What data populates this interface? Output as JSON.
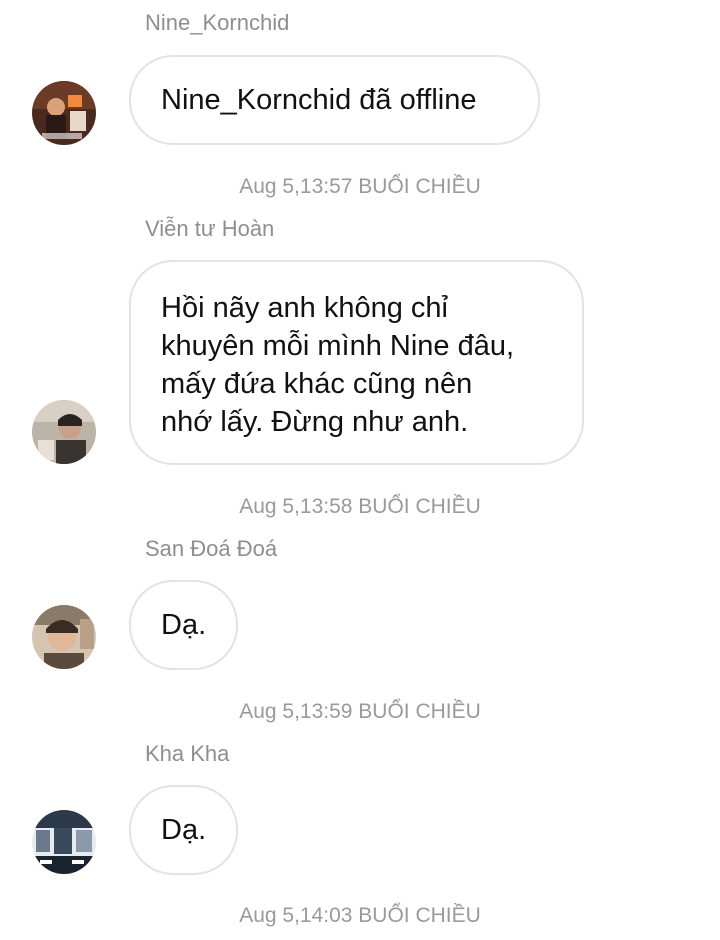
{
  "chat": {
    "messages": [
      {
        "sender": "Nine_Kornchid",
        "text": "Nine_Kornchid đã offline",
        "timestamp": "Aug 5,13:57 BUỔI CHIỀU",
        "avatar": "user-avatar-photo"
      },
      {
        "sender": "Viễn tư Hoàn",
        "text_lines": [
          "Hồi nãy anh không chỉ",
          "khuyên mỗi mình Nine đâu,",
          "mấy đứa khác cũng nên",
          "nhớ lấy. Đừng như anh."
        ],
        "timestamp": "Aug 5,13:58 BUỔI CHIỀU",
        "avatar": "user-avatar-photo"
      },
      {
        "sender": "San Đoá Đoá",
        "text": "Dạ.",
        "timestamp": "Aug 5,13:59 BUỔI CHIỀU",
        "avatar": "user-avatar-photo"
      },
      {
        "sender": "Kha Kha",
        "text": "Dạ.",
        "timestamp": "Aug 5,14:03 BUỔI CHIỀU",
        "avatar": "user-avatar-photo"
      }
    ]
  },
  "colors": {
    "sender_name": "#8e8e8e",
    "timestamp": "#9a9a9a",
    "bubble_border": "#e3e3e3",
    "message_text": "#111111",
    "background": "#ffffff"
  }
}
